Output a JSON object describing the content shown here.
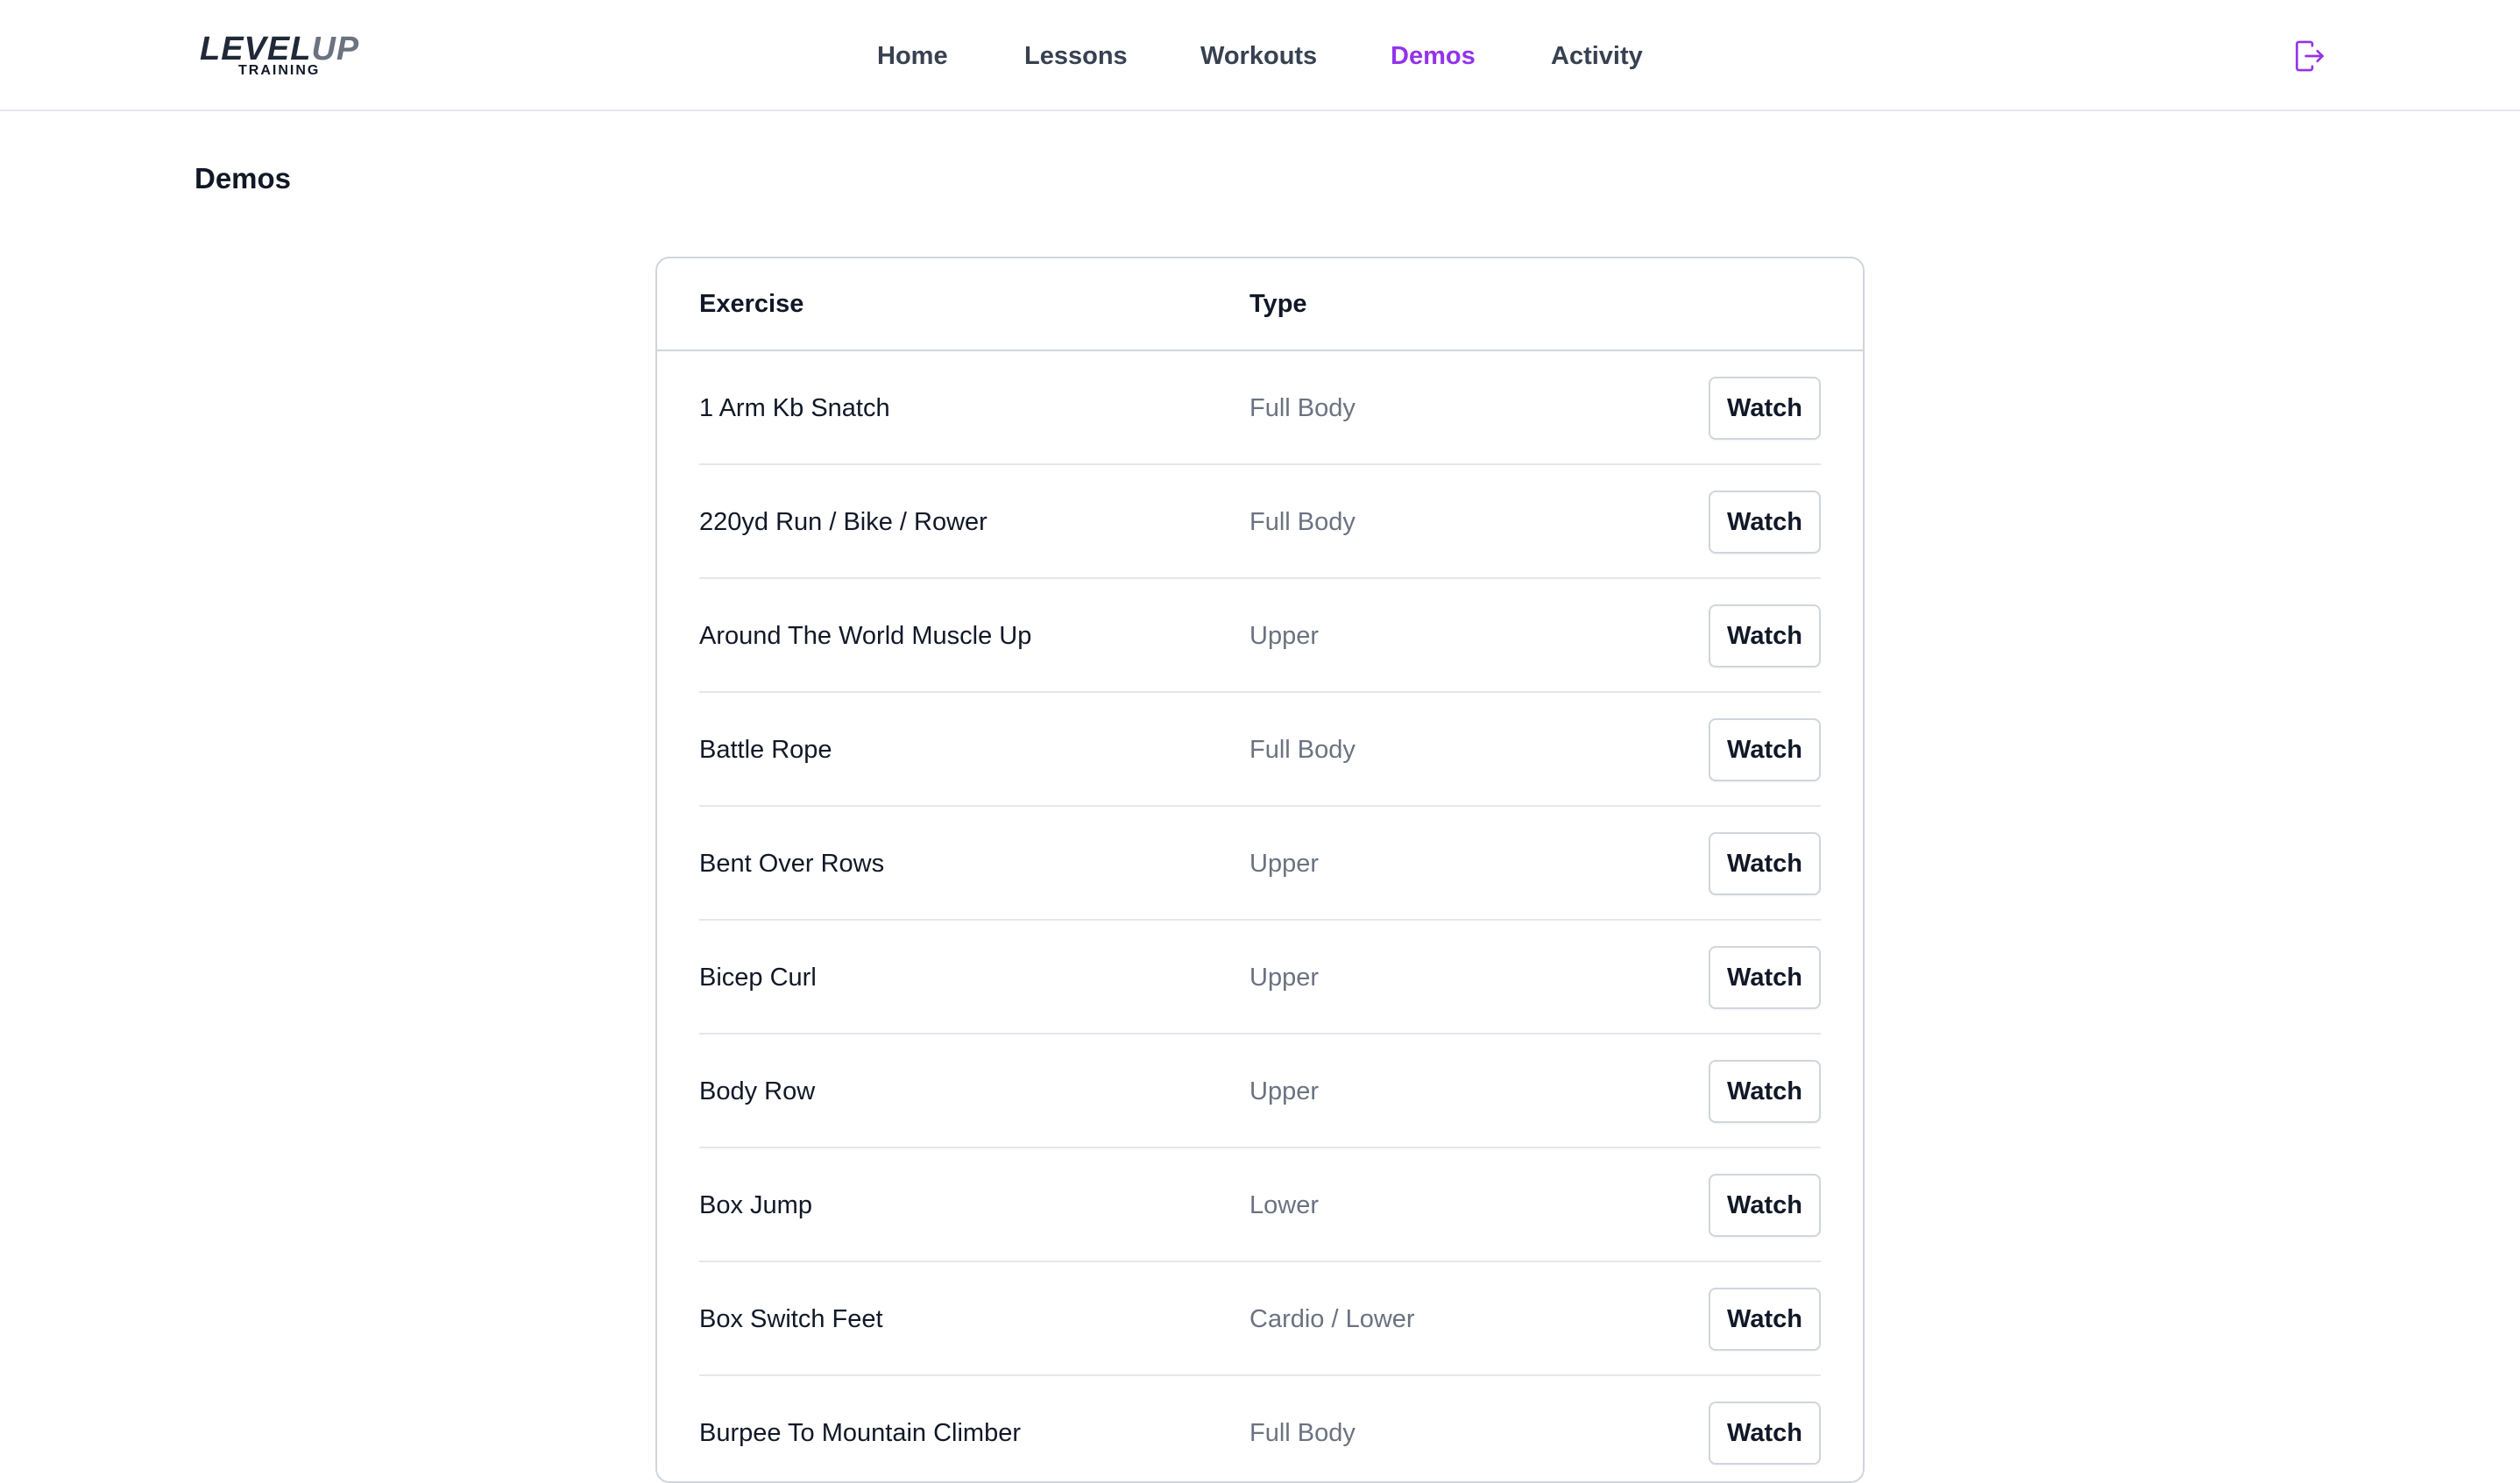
{
  "brand": {
    "logo_main_a": "LEVEL",
    "logo_main_b": "UP",
    "logo_sub": "TRAINING"
  },
  "nav": {
    "items": [
      {
        "label": "Home"
      },
      {
        "label": "Lessons"
      },
      {
        "label": "Workouts"
      },
      {
        "label": "Demos"
      },
      {
        "label": "Activity"
      }
    ],
    "active": "Demos",
    "accent_color": "#9333ea",
    "logout_icon": "logout-icon"
  },
  "page": {
    "title": "Demos"
  },
  "table": {
    "columns": [
      "Exercise",
      "Type"
    ],
    "action_label": "Watch",
    "rows": [
      {
        "exercise": "1 Arm Kb Snatch",
        "type": "Full Body"
      },
      {
        "exercise": "220yd Run / Bike / Rower",
        "type": "Full Body"
      },
      {
        "exercise": "Around The World Muscle Up",
        "type": "Upper"
      },
      {
        "exercise": "Battle Rope",
        "type": "Full Body"
      },
      {
        "exercise": "Bent Over Rows",
        "type": "Upper"
      },
      {
        "exercise": "Bicep Curl",
        "type": "Upper"
      },
      {
        "exercise": "Body Row",
        "type": "Upper"
      },
      {
        "exercise": "Box Jump",
        "type": "Lower"
      },
      {
        "exercise": "Box Switch Feet",
        "type": "Cardio / Lower"
      },
      {
        "exercise": "Burpee To Mountain Climber",
        "type": "Full Body"
      }
    ]
  }
}
